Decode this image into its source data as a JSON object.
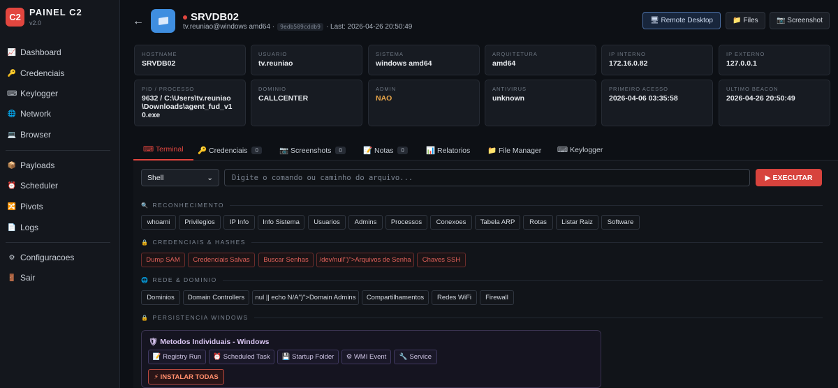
{
  "brand": {
    "logo": "C2",
    "title": "PAINEL C2",
    "version": "v2.0"
  },
  "nav": {
    "group1": [
      {
        "icon": "📈",
        "label": "Dashboard"
      },
      {
        "icon": "🔑",
        "label": "Credenciais"
      },
      {
        "icon": "⌨",
        "label": "Keylogger"
      },
      {
        "icon": "🌐",
        "label": "Network"
      },
      {
        "icon": "💻",
        "label": "Browser"
      }
    ],
    "group2": [
      {
        "icon": "📦",
        "label": "Payloads"
      },
      {
        "icon": "⏰",
        "label": "Scheduler"
      },
      {
        "icon": "🔀",
        "label": "Pivots"
      },
      {
        "icon": "📄",
        "label": "Logs"
      }
    ],
    "group3": [
      {
        "icon": "⚙",
        "label": "Configuracoes"
      },
      {
        "icon": "🚪",
        "label": "Sair"
      }
    ]
  },
  "header": {
    "back_icon": "←",
    "name": "SRVDB02",
    "user_os": "tv.reuniao@windows amd64 ·",
    "hash": "9edb509cddb9",
    "last_seen": "· Last: 2026-04-26 20:50:49",
    "buttons": {
      "remote_desktop": "🖥 Remote Desktop",
      "files": "📁 Files",
      "screenshot": "📷 Screenshot"
    }
  },
  "info_cards": [
    {
      "label": "HOSTNAME",
      "value": "SRVDB02"
    },
    {
      "label": "USUARIO",
      "value": "tv.reuniao"
    },
    {
      "label": "SISTEMA",
      "value": "windows amd64"
    },
    {
      "label": "ARQUITETURA",
      "value": "amd64"
    },
    {
      "label": "IP INTERNO",
      "value": "172.16.0.82"
    },
    {
      "label": "IP EXTERNO",
      "value": "127.0.0.1"
    },
    {
      "label": "PID / PROCESSO",
      "value": "9632 / C:\\Users\\tv.reuniao\\Downloads\\agent_fud_v10.exe"
    },
    {
      "label": "DOMINIO",
      "value": "CALLCENTER"
    },
    {
      "label": "ADMIN",
      "value": "NAO"
    },
    {
      "label": "ANTIVIRUS",
      "value": "unknown"
    },
    {
      "label": "PRIMEIRO ACESSO",
      "value": "2026-04-06 03:35:58"
    },
    {
      "label": "ULTIMO BEACON",
      "value": "2026-04-26 20:50:49"
    }
  ],
  "tabs": [
    {
      "label": "⌨ Terminal"
    },
    {
      "label": "🔑 Credenciais",
      "badge": "0"
    },
    {
      "label": "📷 Screenshots",
      "badge": "0"
    },
    {
      "label": "📝 Notas",
      "badge": "0"
    },
    {
      "label": "📊 Relatorios"
    },
    {
      "label": "📁 File Manager"
    },
    {
      "label": "⌨ Keylogger"
    }
  ],
  "terminal": {
    "shell_value": "Shell",
    "shell_chevron": "⌄",
    "input_placeholder": "Digite o comando ou caminho do arquivo...",
    "run_label": "▶ EXECUTAR"
  },
  "sections": {
    "recon": {
      "icon": "🔍",
      "title": "RECONHECIMENTO",
      "commands": [
        "whoami",
        "Privilegios",
        "IP Info",
        "Info Sistema",
        "Usuarios",
        "Admins",
        "Processos",
        "Conexoes",
        "Tabela ARP",
        "Rotas",
        "Listar Raiz",
        "Software"
      ]
    },
    "creds": {
      "icon": "🔒",
      "title": "CREDENCIAIS & HASHES",
      "commands": [
        "Dump SAM",
        "Credenciais Salvas",
        "Buscar Senhas",
        "/dev/null\")\">Arquivos de Senha",
        "Chaves SSH"
      ]
    },
    "network": {
      "icon": "🌐",
      "title": "REDE & DOMINIO",
      "commands": [
        "Dominios",
        "Domain Controllers",
        "nul || echo N/A\")\">Domain Admins",
        "Compartilhamentos",
        "Redes WiFi",
        "Firewall"
      ]
    },
    "persist": {
      "icon": "🔒",
      "title": "PERSISTENCIA WINDOWS",
      "box_title": "🛡 Metodos Individuais - Windows",
      "methods": [
        "📝 Registry Run",
        "⏰ Scheduled Task",
        "💾 Startup Folder",
        "⚙ WMI Event",
        "🔧 Service"
      ],
      "install_all": "⚡ INSTALAR TODAS"
    }
  },
  "colors": {
    "accent": "#e2463f",
    "primary_btn": "#18263c",
    "persist_border": "#3a3350"
  }
}
